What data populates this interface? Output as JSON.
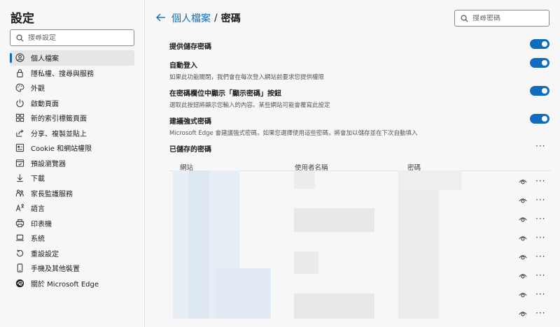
{
  "sidebar": {
    "title": "設定",
    "search_placeholder": "搜尋設定",
    "items": [
      {
        "label": "個人檔案"
      },
      {
        "label": "隱私權、搜尋與服務"
      },
      {
        "label": "外觀"
      },
      {
        "label": "啟動頁面"
      },
      {
        "label": "新的索引標籤頁面"
      },
      {
        "label": "分享、複製並貼上"
      },
      {
        "label": "Cookie 和網站權限"
      },
      {
        "label": "預設瀏覽器"
      },
      {
        "label": "下載"
      },
      {
        "label": "家長監護服務"
      },
      {
        "label": "語言"
      },
      {
        "label": "印表機"
      },
      {
        "label": "系統"
      },
      {
        "label": "重設設定"
      },
      {
        "label": "手機及其他裝置"
      },
      {
        "label": "關於 Microsoft Edge"
      }
    ]
  },
  "header": {
    "breadcrumb_parent": "個人檔案",
    "breadcrumb_sep": "/",
    "breadcrumb_current": "密碼",
    "search_placeholder": "搜尋密碼"
  },
  "settings": [
    {
      "title": "提供儲存密碼",
      "desc": "",
      "on": true
    },
    {
      "title": "自動登入",
      "desc": "如果此功能關閉，我們會在每次登入網站前要求您提供權限",
      "on": true
    },
    {
      "title": "在密碼欄位中顯示「顯示密碼」按鈕",
      "desc": "選取此按鈕將顯示您輸入的內容。某些網站可能會覆寫此設定",
      "on": true
    },
    {
      "title": "建議強式密碼",
      "desc": "Microsoft Edge 會建議強式密碼，如果您選擇使用這些密碼，將會加以儲存並在下次自動填入",
      "on": true
    }
  ],
  "saved": {
    "title": "已儲存的密碼",
    "columns": [
      "網站",
      "使用者名稱",
      "密碼"
    ]
  },
  "colors": {
    "accent": "#0f6cbd"
  }
}
